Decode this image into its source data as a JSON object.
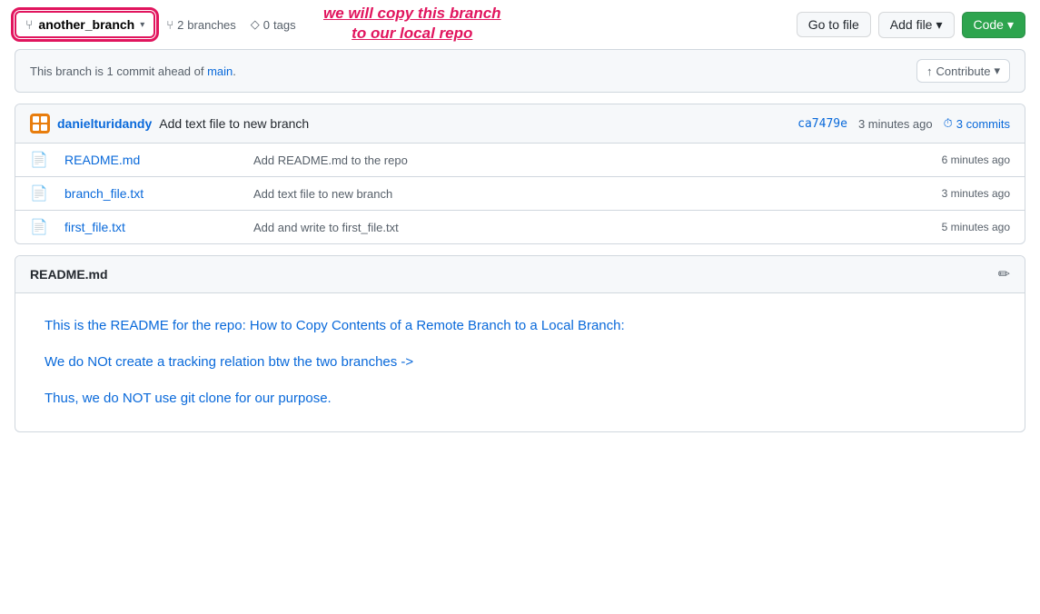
{
  "toolbar": {
    "branch_name": "another_branch",
    "branch_icon": "⑂",
    "branches_count": "2",
    "branches_label": "branches",
    "tags_count": "0",
    "tags_label": "tags",
    "annotation_line1": "we will copy this branch",
    "annotation_line2": "to our local repo",
    "go_to_file_label": "Go to file",
    "add_file_label": "Add file",
    "code_label": "Code"
  },
  "commit_banner": {
    "text": "This branch is 1 commit ahead of main.",
    "link_text": "main",
    "contribute_label": "Contribute",
    "contribute_icon": "↑"
  },
  "file_table": {
    "header": {
      "author_name": "danielturidandy",
      "commit_message": "Add text file to new branch",
      "commit_sha": "ca7479e",
      "commit_time": "3 minutes ago",
      "commits_label": "3 commits",
      "clock_icon": "⏱"
    },
    "files": [
      {
        "name": "README.md",
        "commit_msg": "Add README.md to the repo",
        "time": "6 minutes ago"
      },
      {
        "name": "branch_file.txt",
        "commit_msg": "Add text file to new branch",
        "time": "3 minutes ago"
      },
      {
        "name": "first_file.txt",
        "commit_msg": "Add and write to first_file.txt",
        "time": "5 minutes ago"
      }
    ]
  },
  "readme": {
    "title": "README.md",
    "lines": [
      "This is the README for the repo: How to Copy Contents of a Remote Branch to a Local Branch:",
      "We do NOt create a tracking relation btw the two branches ->",
      "Thus, we do NOT use git clone for our purpose."
    ]
  }
}
